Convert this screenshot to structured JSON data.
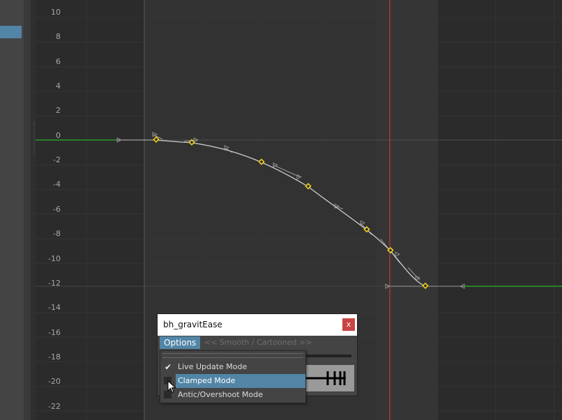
{
  "graph": {
    "y_ticks": [
      "10",
      "8",
      "6",
      "4",
      "2",
      "0",
      "-2",
      "-4",
      "-6",
      "-8",
      "-10",
      "-12",
      "-14",
      "-16",
      "-18",
      "-20",
      "-22"
    ],
    "colors": {
      "background": "#2b2b2b",
      "curve": "#cfcfcf",
      "key": "#f2d21b",
      "pre_infinity": "#2c9a2c",
      "current_time": "#d93a3a"
    },
    "keys": [
      {
        "time": 0,
        "value": 0
      },
      {
        "time": 1,
        "value": -0.25
      },
      {
        "time": 3,
        "value": -1.9
      },
      {
        "time": 4.3,
        "value": -3.9
      },
      {
        "time": 5.9,
        "value": -7.3
      },
      {
        "time": 6.6,
        "value": -9.0
      },
      {
        "time": 7.6,
        "value": -12
      }
    ]
  },
  "dialog": {
    "title": "bh_gravitEase",
    "close_label": "x",
    "options_label": "Options",
    "mode_label": "<< Smooth / Cartooned >>"
  },
  "dropdown": {
    "items": [
      {
        "label": "Live Update Mode",
        "checked": true
      },
      {
        "label": "Clamped Mode",
        "checked": false,
        "highlighted": true
      },
      {
        "label": "Antic/Overshoot Mode",
        "checked": false
      }
    ]
  }
}
